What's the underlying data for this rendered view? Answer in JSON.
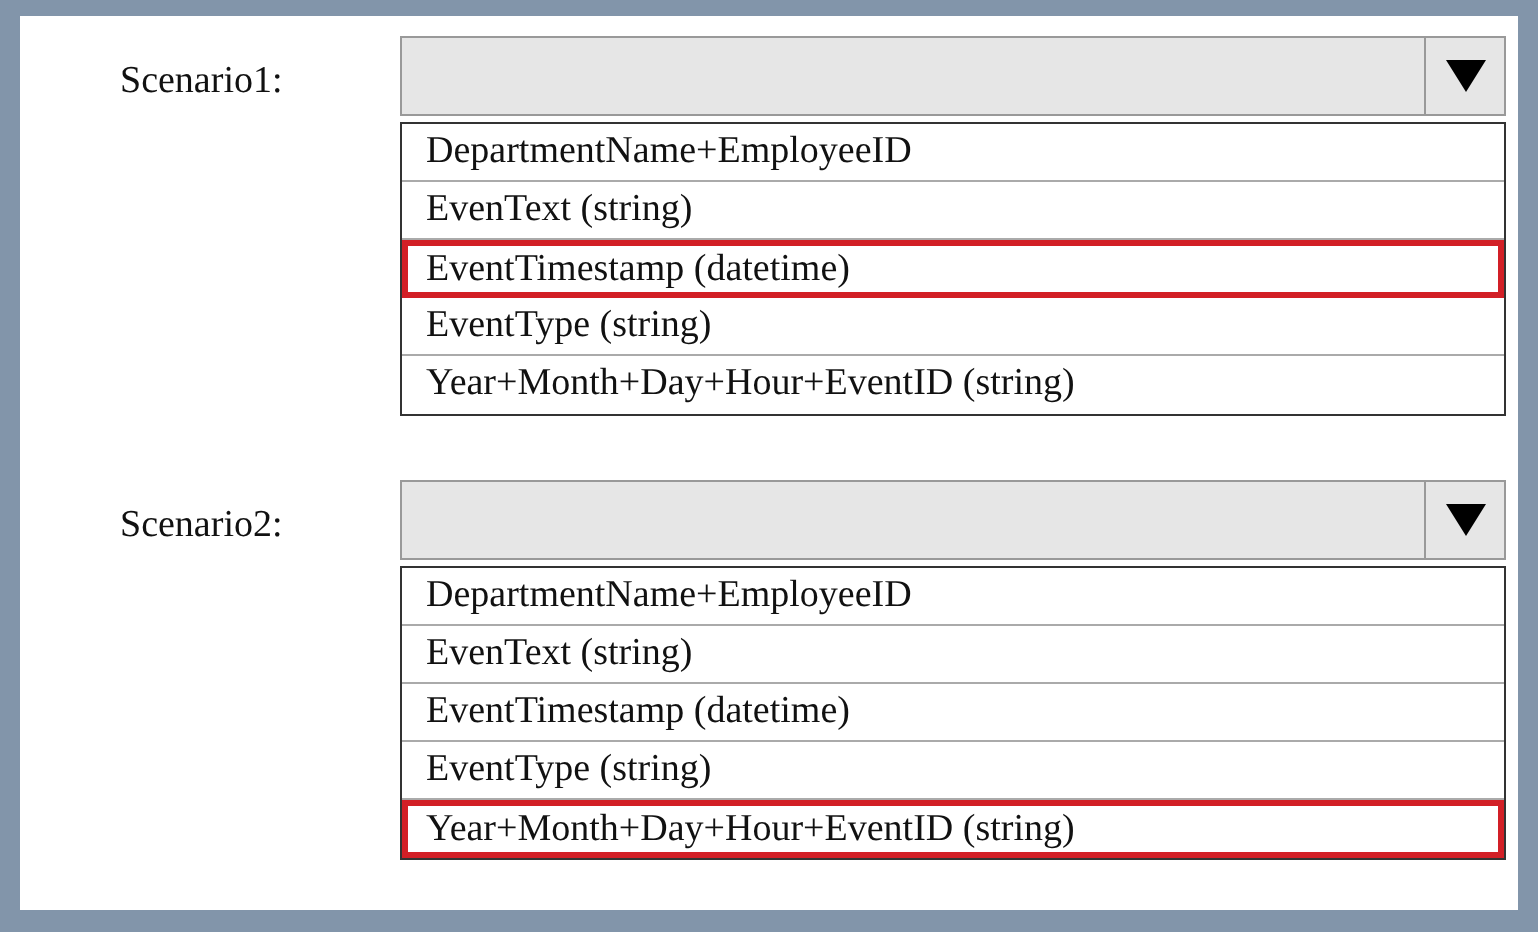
{
  "scenarios": [
    {
      "label": "Scenario1:",
      "options": [
        {
          "text": "DepartmentName+EmployeeID",
          "selected": false
        },
        {
          "text": "EvenText (string)",
          "selected": false
        },
        {
          "text": "EventTimestamp (datetime)",
          "selected": true
        },
        {
          "text": "EventType (string)",
          "selected": false
        },
        {
          "text": "Year+Month+Day+Hour+EventID (string)",
          "selected": false
        }
      ]
    },
    {
      "label": "Scenario2:",
      "options": [
        {
          "text": "DepartmentName+EmployeeID",
          "selected": false
        },
        {
          "text": "EvenText (string)",
          "selected": false
        },
        {
          "text": "EventTimestamp (datetime)",
          "selected": false
        },
        {
          "text": "EventType (string)",
          "selected": false
        },
        {
          "text": "Year+Month+Day+Hour+EventID (string)",
          "selected": true
        }
      ]
    }
  ]
}
